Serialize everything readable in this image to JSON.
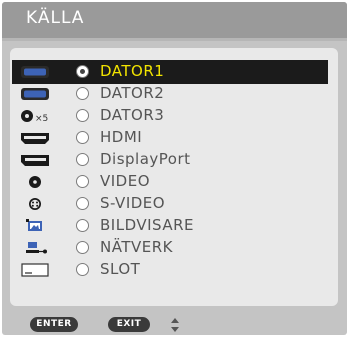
{
  "title": "KÄLLA",
  "sources": [
    {
      "label": "DATOR1",
      "icon": "computer-input-icon",
      "selected": true
    },
    {
      "label": "DATOR2",
      "icon": "computer-input-icon",
      "selected": false
    },
    {
      "label": "DATOR3",
      "icon": "bnc-x5-input-icon",
      "icon_text": "×5",
      "selected": false
    },
    {
      "label": "HDMI",
      "icon": "hdmi-connector-icon",
      "selected": false
    },
    {
      "label": "DisplayPort",
      "icon": "displayport-connector-icon",
      "selected": false
    },
    {
      "label": "VIDEO",
      "icon": "rca-video-icon",
      "selected": false
    },
    {
      "label": "S-VIDEO",
      "icon": "svideo-connector-icon",
      "selected": false
    },
    {
      "label": "BILDVISARE",
      "icon": "viewer-icon",
      "selected": false
    },
    {
      "label": "NÄTVERK",
      "icon": "network-icon",
      "selected": false
    },
    {
      "label": "SLOT",
      "icon": "slot-icon",
      "selected": false
    }
  ],
  "footer": {
    "enter": "ENTER",
    "exit": "EXIT",
    "arrows_icon": "up-down-arrows-icon"
  },
  "colors": {
    "selected_text": "#f2e400",
    "highlight": "#1b1b1b",
    "frame": "#c4c4c4",
    "title_bar": "#9a9a9a"
  }
}
